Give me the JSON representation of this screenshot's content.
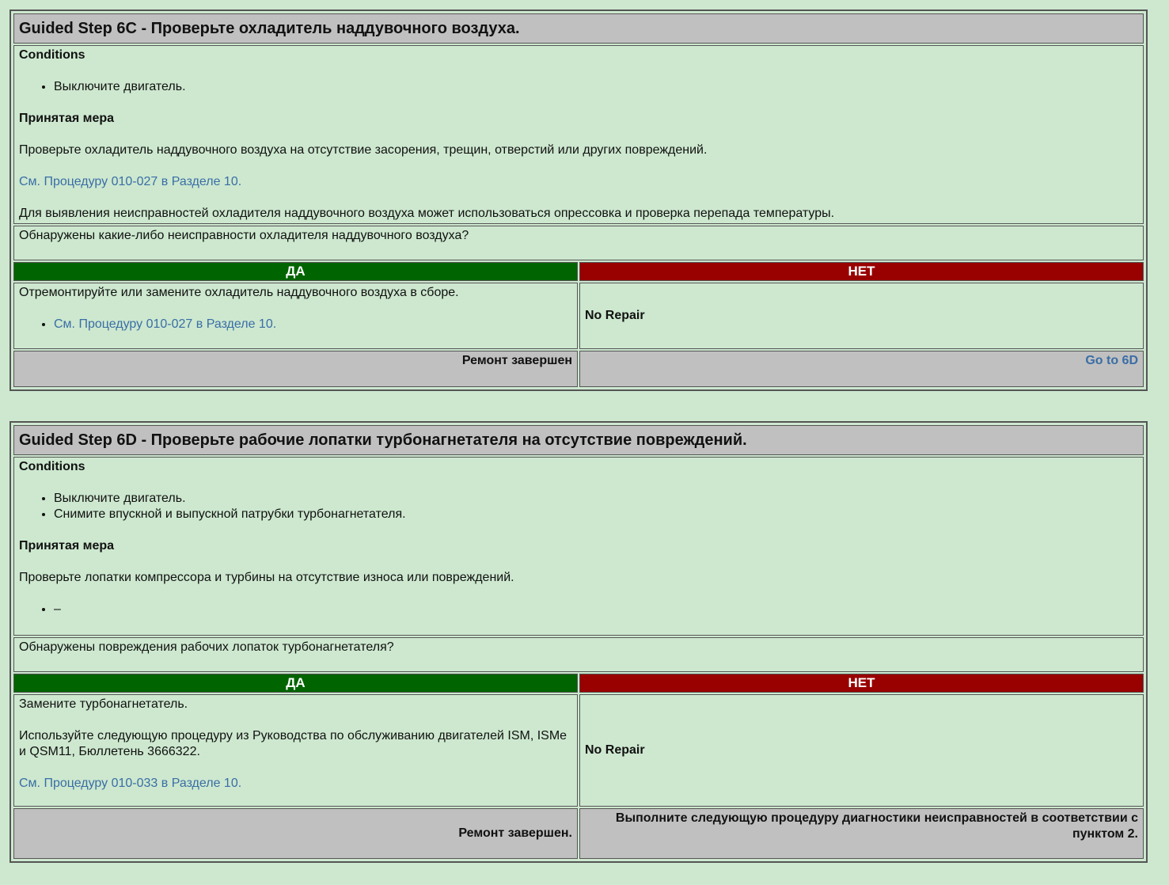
{
  "steps": [
    {
      "title": "Guided Step 6C - Проверьте охладитель наддувочного воздуха.",
      "conditions_label": "Conditions",
      "conditions": [
        "Выключите двигатель."
      ],
      "action_label": "Принятая мера",
      "action_text": "Проверьте охладитель наддувочного воздуха на отсутствие засорения, трещин, отверстий или других повреждений.",
      "action_link": "См. Процедуру 010-027 в Разделе 10.",
      "action_note": "Для выявления неисправностей охладителя наддувочного воздуха может использоваться опрессовка и проверка перепада температуры.",
      "question": "Обнаружены какие-либо неисправности охладителя наддувочного воздуха?",
      "yes_label": "ДА",
      "no_label": "НЕТ",
      "yes_text": "Отремонтируйте или замените охладитель наддувочного воздуха в сборе.",
      "yes_link": "См. Процедуру 010-027 в Разделе 10.",
      "no_text": "No Repair",
      "yes_footer": "Ремонт завершен",
      "no_footer": "Go to 6D"
    },
    {
      "title": "Guided Step 6D - Проверьте рабочие лопатки турбонагнетателя на отсутствие повреждений.",
      "conditions_label": "Conditions",
      "conditions": [
        "Выключите двигатель.",
        "Снимите впускной и выпускной патрубки турбонагнетателя."
      ],
      "action_label": "Принятая мера",
      "action_text": "Проверьте лопатки компрессора и турбины на отсутствие износа или повреждений.",
      "action_bullet": "–",
      "question": "Обнаружены повреждения рабочих лопаток турбонагнетателя?",
      "yes_label": "ДА",
      "no_label": "НЕТ",
      "yes_text": "Замените турбонагнетатель.",
      "yes_text2": "Используйте следующую процедуру из Руководства по обслуживанию двигателей ISM, ISMe и QSM11, Бюллетень 3666322.",
      "yes_link": "См. Процедуру 010-033 в Разделе 10.",
      "no_text": "No Repair",
      "yes_footer": "Ремонт завершен.",
      "no_footer": "Выполните следующую процедуру диагностики неисправностей в соответствии с пунктом 2."
    }
  ]
}
